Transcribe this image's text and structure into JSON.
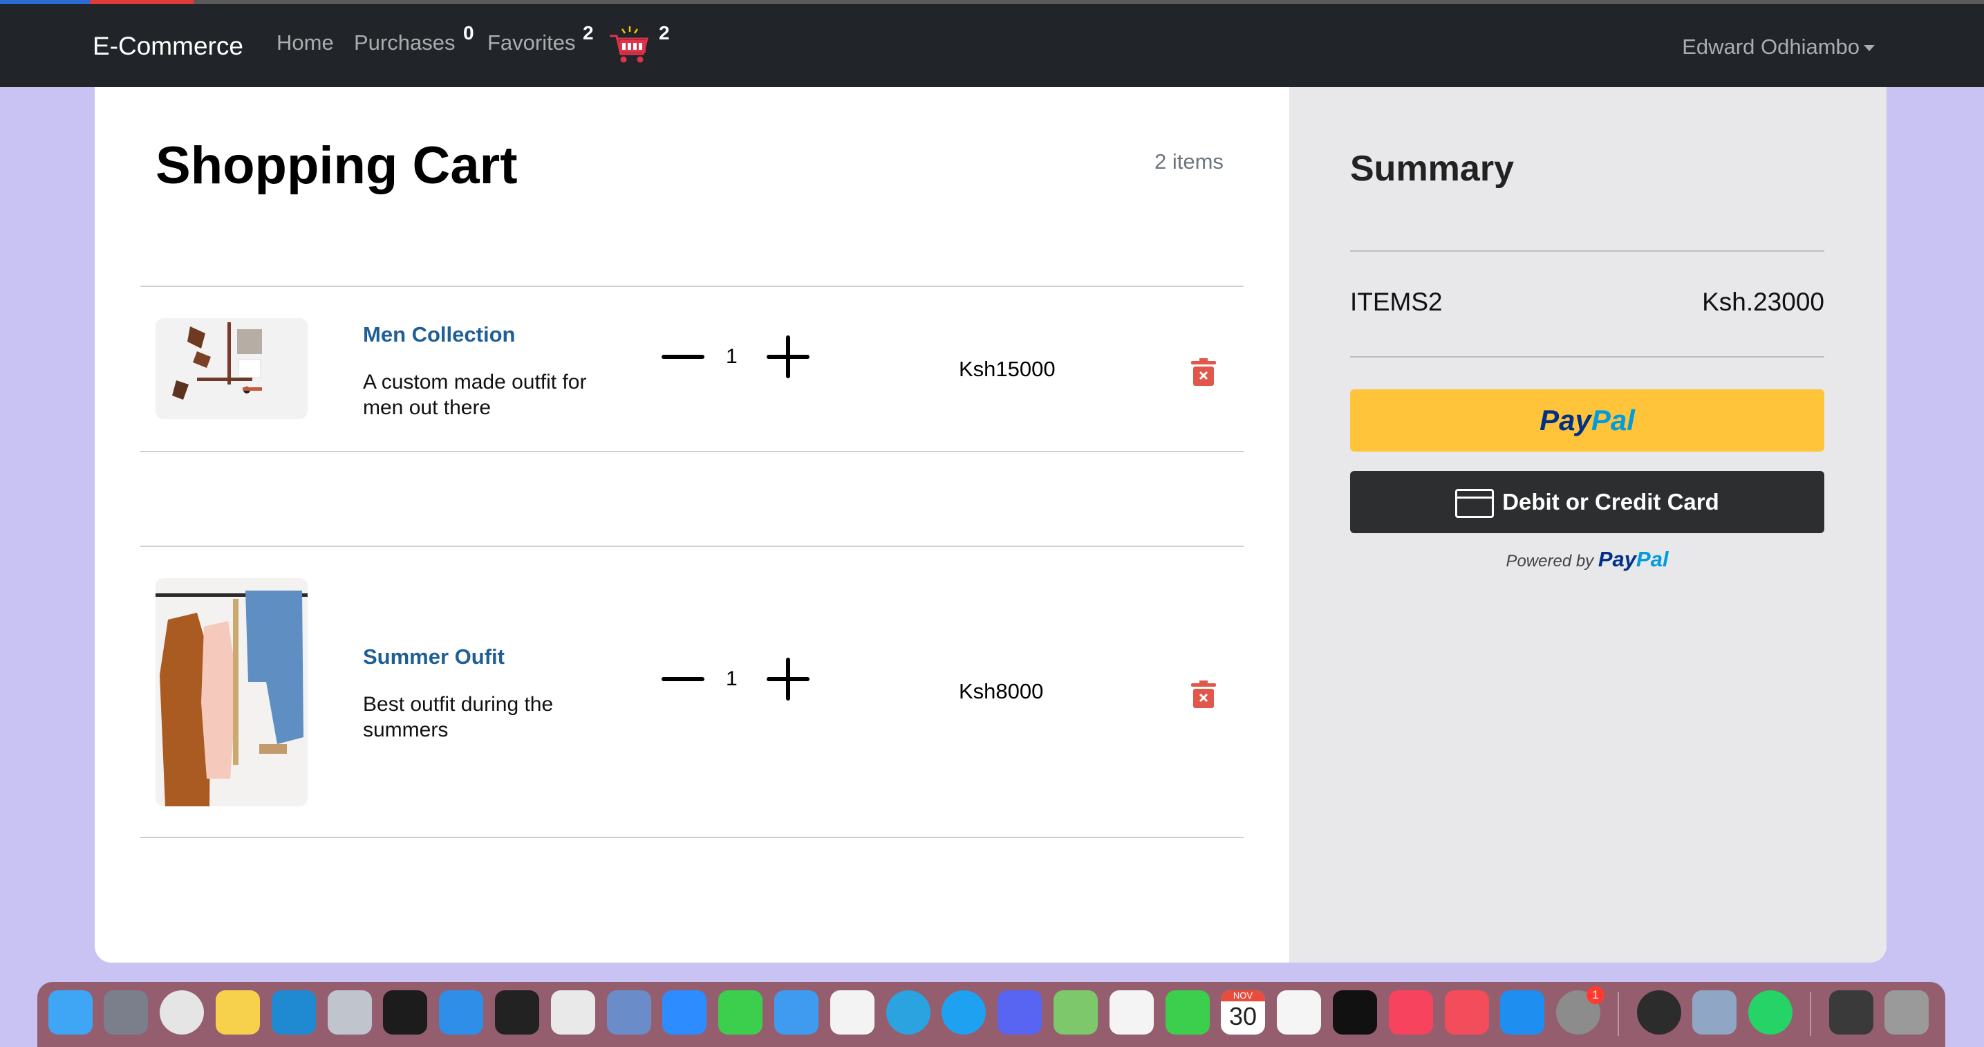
{
  "navbar": {
    "brand": "E-Commerce",
    "links": [
      {
        "label": "Home"
      },
      {
        "label": "Purchases",
        "badge": "0"
      },
      {
        "label": "Favorites",
        "badge": "2"
      }
    ],
    "cart_badge": "2",
    "user": "Edward Odhiambo"
  },
  "cart": {
    "title": "Shopping Cart",
    "count_label": "2 items",
    "items": [
      {
        "name": "Men Collection",
        "description": "A custom made outfit for men out there",
        "quantity": "1",
        "price": "Ksh15000"
      },
      {
        "name": "Summer Oufit",
        "description": "Best outfit during the summers",
        "quantity": "1",
        "price": "Ksh8000"
      }
    ]
  },
  "summary": {
    "title": "Summary",
    "items_label": "ITEMS2",
    "total": "Ksh.23000",
    "paypal_pay": "Pay",
    "paypal_pal": "Pal",
    "card_button": "Debit or Credit Card",
    "powered_by": "Powered by"
  },
  "dock": {
    "calendar_month": "NOV",
    "calendar_day": "30",
    "badge": "1"
  },
  "colors": {
    "navbar": "#212529",
    "product_link": "#1f5f96",
    "paypal_yellow": "#ffc439",
    "card_dark": "#2c2e2f",
    "trash_red": "#e2574c"
  }
}
